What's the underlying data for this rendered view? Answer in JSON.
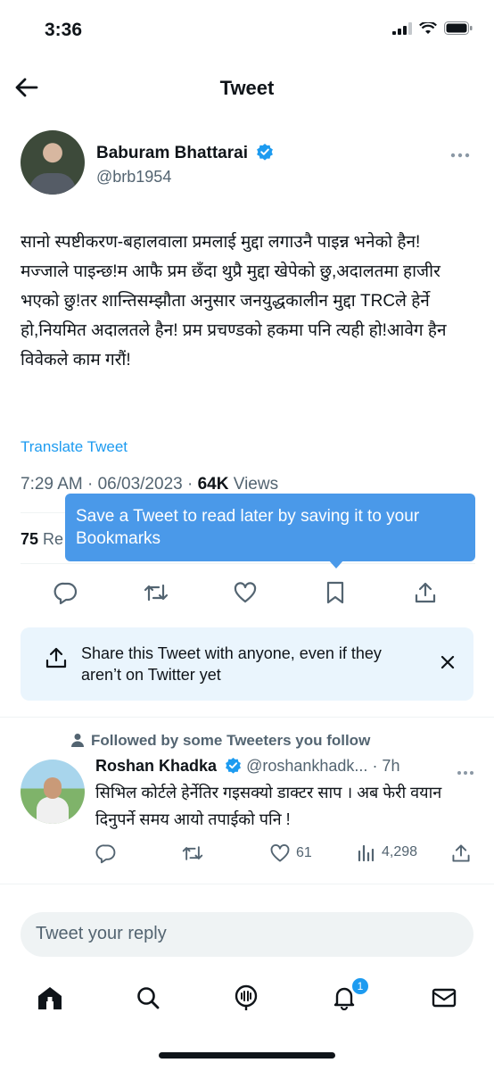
{
  "status_bar": {
    "time": "3:36"
  },
  "header": {
    "title": "Tweet"
  },
  "tweet": {
    "author_name": "Baburam Bhattarai",
    "author_handle": "@brb1954",
    "text": "सानो स्पष्टीकरण-बहालवाला प्रमलाई मुद्दा लगाउनै पाइन्न भनेको हैन!मज्जाले पाइन्छ!म आफै प्रम छँदा थुप्रै मुद्दा खेपेको छु,अदालतमा हाजीर भएको छु!तर शान्तिसम्झौता अनुसार जनयुद्धकालीन मुद्दा TRCले हेर्ने हो,नियमित अदालतले हैन! प्रम प्रचण्डको हकमा पनि त्यही हो!आवेग हैन विवेकले काम गरौं!",
    "translate_label": "Translate Tweet",
    "time": "7:29 AM",
    "date": "06/03/2023",
    "views_count": "64K",
    "views_label": "Views",
    "retweets_count": "75",
    "retweets_label_partial": "Re"
  },
  "tooltip": {
    "text": "Save a Tweet to read later by saving it to your Bookmarks"
  },
  "share_card": {
    "text": "Share this Tweet with anyone, even if they aren’t on Twitter yet"
  },
  "reply": {
    "social_context": "Followed by some Tweeters you follow",
    "name": "Roshan Khadka",
    "handle": "@roshankhadk...",
    "time": "· 7h",
    "text": "सिभिल कोर्टले हेर्नेतिर गइसक्यो डाक्टर साप । अब फेरी वयान दिनुपर्ने समय आयो तपाईको पनि !",
    "likes": "61",
    "views": "4,298"
  },
  "composer": {
    "placeholder": "Tweet your reply"
  },
  "tabbar": {
    "notifications_badge": "1"
  },
  "colors": {
    "accent": "#1d9bf0",
    "tooltip": "#4a99e9",
    "share_card_bg": "#eaf5fd",
    "text": "#0f1419",
    "muted": "#536471"
  }
}
